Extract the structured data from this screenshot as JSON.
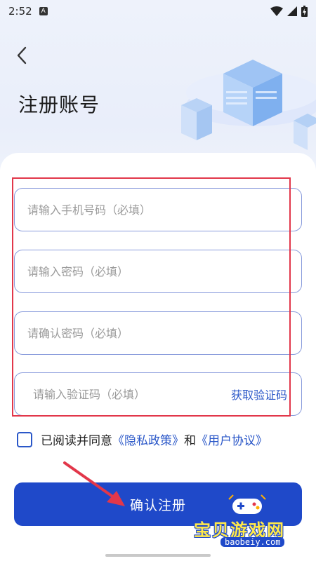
{
  "status": {
    "time": "2:52",
    "app_badge": "A"
  },
  "header": {
    "title": "注册账号"
  },
  "form": {
    "phone_placeholder": "请输入手机号码（必填）",
    "password_placeholder": "请输入密码（必填）",
    "confirm_placeholder": "请确认密码（必填）",
    "code_placeholder": "请输入验证码（必填）",
    "get_code_label": "获取验证码"
  },
  "agreement": {
    "prefix": "已阅读并同意",
    "privacy_link": "《隐私政策》",
    "and": "和",
    "user_link": "《用户协议》",
    "checked": false
  },
  "submit_label": "确认注册",
  "watermark": {
    "title": "宝贝游戏网",
    "url": "baobeiy.com"
  },
  "colors": {
    "accent": "#1f49c9",
    "link": "#2a57c8",
    "highlight": "#e2374a"
  }
}
